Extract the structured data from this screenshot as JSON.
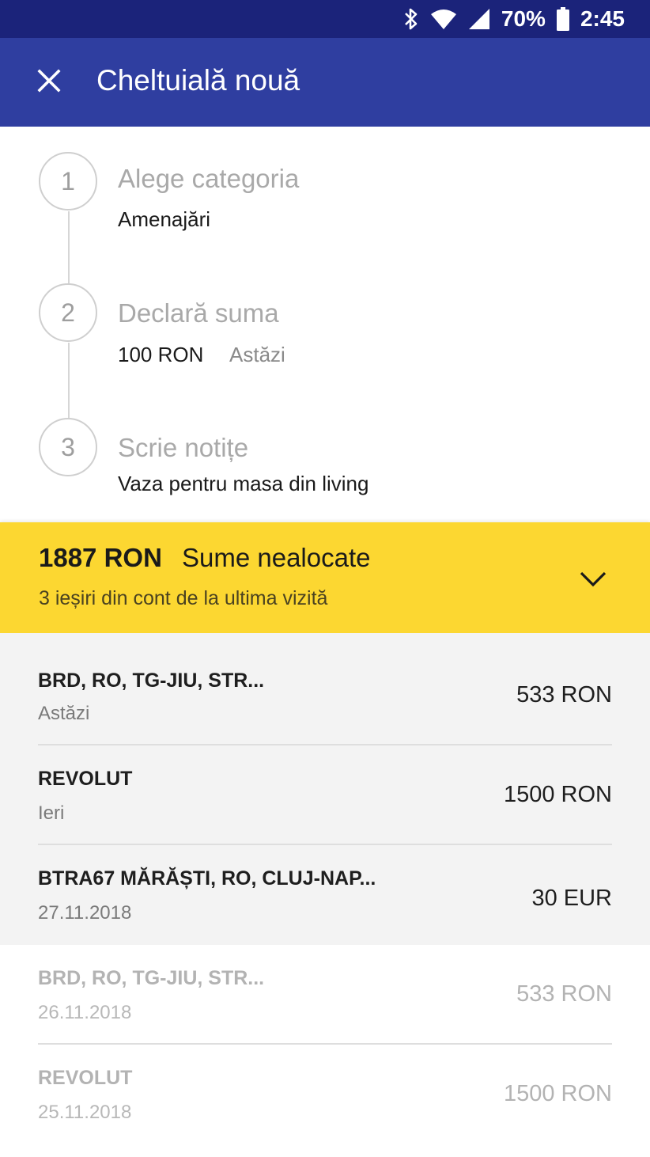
{
  "status_bar": {
    "battery": "70%",
    "time": "2:45",
    "icons": [
      "bluetooth-icon",
      "wifi-icon",
      "signal-icon",
      "battery-icon"
    ]
  },
  "app_bar": {
    "title": "Cheltuială nouă",
    "close_icon": "close-icon"
  },
  "steps": [
    {
      "number": "1",
      "title": "Alege categoria",
      "value": "Amenajări"
    },
    {
      "number": "2",
      "title": "Declară suma",
      "value": "100 RON",
      "value_secondary": "Astăzi"
    },
    {
      "number": "3",
      "title": "Scrie notițe",
      "value": "Vaza pentru masa din living"
    }
  ],
  "unallocated": {
    "amount": "1887 RON",
    "title": "Sume nealocate",
    "subtitle": "3 ieșiri din cont de la ultima vizită",
    "expand_icon": "chevron-down-icon"
  },
  "transactions": [
    {
      "name": "BRD, RO, TG-JIU, STR...",
      "date": "Astăzi",
      "amount": "533 RON",
      "state": "new"
    },
    {
      "name": "REVOLUT",
      "date": "Ieri",
      "amount": "1500 RON",
      "state": "new"
    },
    {
      "name": "BTRA67 MĂRĂȘTI, RO, CLUJ-NAP...",
      "date": "27.11.2018",
      "amount": "30 EUR",
      "state": "new"
    },
    {
      "name": "BRD, RO, TG-JIU, STR...",
      "date": "26.11.2018",
      "amount": "533 RON",
      "state": "old"
    },
    {
      "name": "REVOLUT",
      "date": "25.11.2018",
      "amount": "1500 RON",
      "state": "old"
    }
  ],
  "colors": {
    "status_bar": "#1b237a",
    "app_bar": "#2f3ea0",
    "alert": "#fcd731",
    "list_highlight": "#f3f3f3"
  }
}
